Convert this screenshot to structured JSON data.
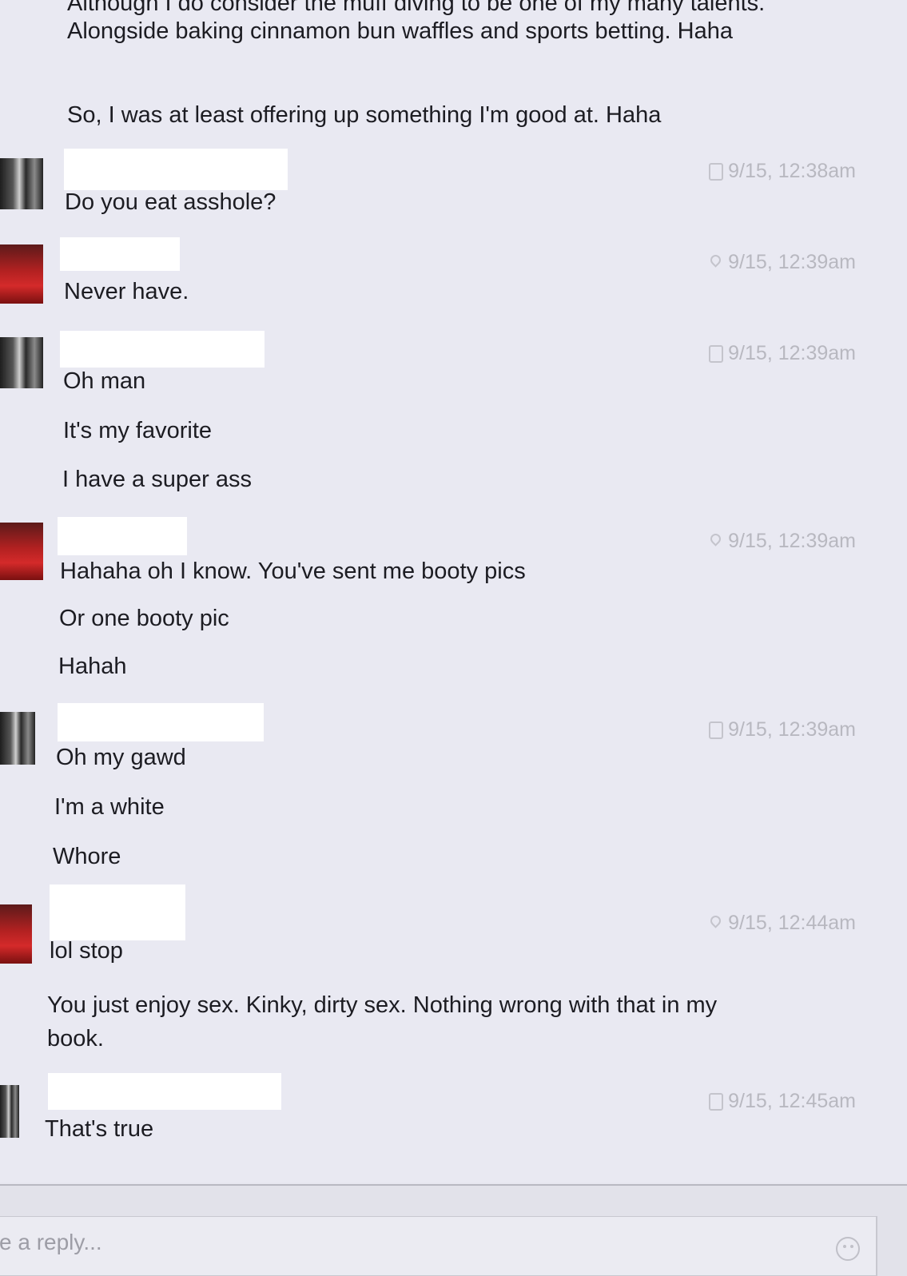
{
  "thread": {
    "continuation": {
      "paragraphs": [
        "Although I do consider the muff diving to be one of my many talents. Alongside baking cinnamon bun waffles and sports betting. Haha",
        "So, I was at least offering up something I'm good at. Haha"
      ]
    },
    "messages": [
      {
        "avatar": "avatar-photo-group",
        "sent_via": "phone-icon",
        "timestamp": "9/15, 12:38am",
        "lines": [
          "Do you eat asshole?"
        ]
      },
      {
        "avatar": "avatar-photo-red",
        "sent_via": "location-pin-icon",
        "timestamp": "9/15, 12:39am",
        "lines": [
          "Never have."
        ]
      },
      {
        "avatar": "avatar-photo-group",
        "sent_via": "phone-icon",
        "timestamp": "9/15, 12:39am",
        "lines": [
          "Oh man",
          "It's my favorite",
          "I have a super ass"
        ]
      },
      {
        "avatar": "avatar-photo-red",
        "sent_via": "location-pin-icon",
        "timestamp": "9/15, 12:39am",
        "lines": [
          "Hahaha oh I know. You've sent me booty pics",
          "Or one booty pic",
          "Hahah"
        ]
      },
      {
        "avatar": "avatar-photo-group",
        "sent_via": "phone-icon",
        "timestamp": "9/15, 12:39am",
        "lines": [
          "Oh my gawd",
          "I'm a white",
          "Whore"
        ]
      },
      {
        "avatar": "avatar-photo-red",
        "sent_via": "location-pin-icon",
        "timestamp": "9/15, 12:44am",
        "lines": [
          "lol stop",
          "You just enjoy sex. Kinky, dirty sex. Nothing wrong with that in my book."
        ]
      },
      {
        "avatar": "avatar-photo-group",
        "sent_via": "phone-icon",
        "timestamp": "9/15, 12:45am",
        "lines": [
          "That's true"
        ]
      }
    ]
  },
  "composer": {
    "placeholder": "ite a reply..."
  }
}
